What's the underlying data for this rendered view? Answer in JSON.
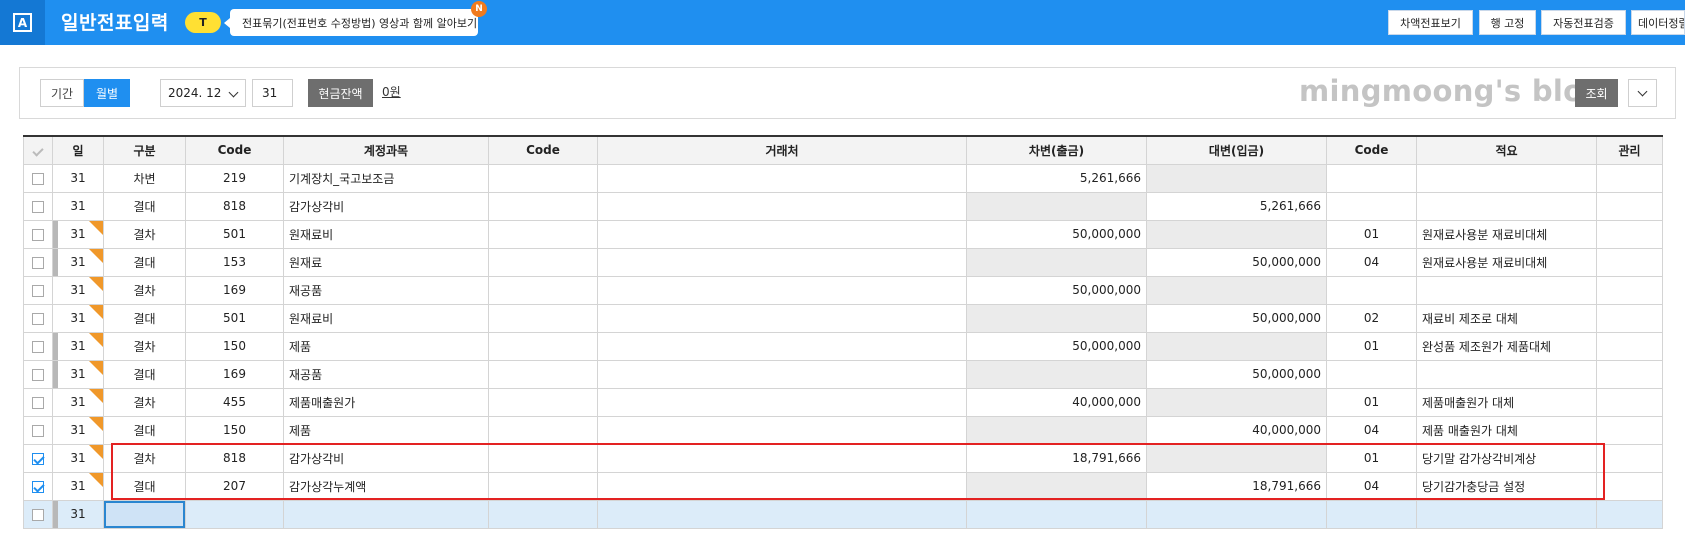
{
  "header": {
    "app_icon_letter": "A",
    "title": "일반전표입력",
    "badge": "T",
    "tip": "전표묶기(전표번호 수정방법) 영상과 함께 알아보기",
    "new_dot": "N",
    "buttons": [
      "차액전표보기",
      "행 고정",
      "자동전표검증",
      "데이터정렬"
    ]
  },
  "filter": {
    "period_label": "기간",
    "monthly_label": "월별",
    "month_value": "2024. 12",
    "day_value": "31",
    "cash_button": "현금잔액",
    "cash_value": "0원",
    "watermark": "mingmoong's blog",
    "lookup_button": "조회"
  },
  "table": {
    "headers": [
      "",
      "일",
      "구분",
      "Code",
      "계정과목",
      "Code",
      "거래처",
      "차변(출금)",
      "대변(입금)",
      "Code",
      "적요",
      "관리"
    ],
    "rows": [
      {
        "day": "31",
        "type": "차변",
        "code": "219",
        "account": "기계장치_국고보조금",
        "debit": "5,261,666",
        "credit": "",
        "memo_code": "",
        "memo": "",
        "checked": false,
        "marked": false,
        "flag": false
      },
      {
        "day": "31",
        "type": "결대",
        "code": "818",
        "account": "감가상각비",
        "debit": "",
        "credit": "5,261,666",
        "memo_code": "",
        "memo": "",
        "checked": false,
        "marked": false,
        "flag": false
      },
      {
        "day": "31",
        "type": "결차",
        "code": "501",
        "account": "원재료비",
        "debit": "50,000,000",
        "credit": "",
        "memo_code": "01",
        "memo": "원재료사용분 재료비대체",
        "checked": false,
        "marked": true,
        "flag": true
      },
      {
        "day": "31",
        "type": "결대",
        "code": "153",
        "account": "원재료",
        "debit": "",
        "credit": "50,000,000",
        "memo_code": "04",
        "memo": "원재료사용분 재료비대체",
        "checked": false,
        "marked": true,
        "flag": true
      },
      {
        "day": "31",
        "type": "결차",
        "code": "169",
        "account": "재공품",
        "debit": "50,000,000",
        "credit": "",
        "memo_code": "",
        "memo": "",
        "checked": false,
        "marked": false,
        "flag": true
      },
      {
        "day": "31",
        "type": "결대",
        "code": "501",
        "account": "원재료비",
        "debit": "",
        "credit": "50,000,000",
        "memo_code": "02",
        "memo": "재료비 제조로 대체",
        "checked": false,
        "marked": false,
        "flag": true
      },
      {
        "day": "31",
        "type": "결차",
        "code": "150",
        "account": "제품",
        "debit": "50,000,000",
        "credit": "",
        "memo_code": "01",
        "memo": "완성품 제조원가 제품대체",
        "checked": false,
        "marked": true,
        "flag": true
      },
      {
        "day": "31",
        "type": "결대",
        "code": "169",
        "account": "재공품",
        "debit": "",
        "credit": "50,000,000",
        "memo_code": "",
        "memo": "",
        "checked": false,
        "marked": true,
        "flag": true
      },
      {
        "day": "31",
        "type": "결차",
        "code": "455",
        "account": "제품매출원가",
        "debit": "40,000,000",
        "credit": "",
        "memo_code": "01",
        "memo": "제품매출원가 대체",
        "checked": false,
        "marked": false,
        "flag": true
      },
      {
        "day": "31",
        "type": "결대",
        "code": "150",
        "account": "제품",
        "debit": "",
        "credit": "40,000,000",
        "memo_code": "04",
        "memo": "제품 매출원가 대체",
        "checked": false,
        "marked": false,
        "flag": true
      },
      {
        "day": "31",
        "type": "결차",
        "code": "818",
        "account": "감가상각비",
        "debit": "18,791,666",
        "credit": "",
        "memo_code": "01",
        "memo": "당기말 감가상각비계상",
        "checked": true,
        "marked": false,
        "flag": true
      },
      {
        "day": "31",
        "type": "결대",
        "code": "207",
        "account": "감가상각누계액",
        "debit": "",
        "credit": "18,791,666",
        "memo_code": "04",
        "memo": "당기감가충당금 설정",
        "checked": true,
        "marked": false,
        "flag": true
      }
    ],
    "new_row_day": "31"
  },
  "colors": {
    "header_blue": "#1f8ff0",
    "flag_orange": "#f0982a",
    "highlight_red": "#e32222"
  }
}
